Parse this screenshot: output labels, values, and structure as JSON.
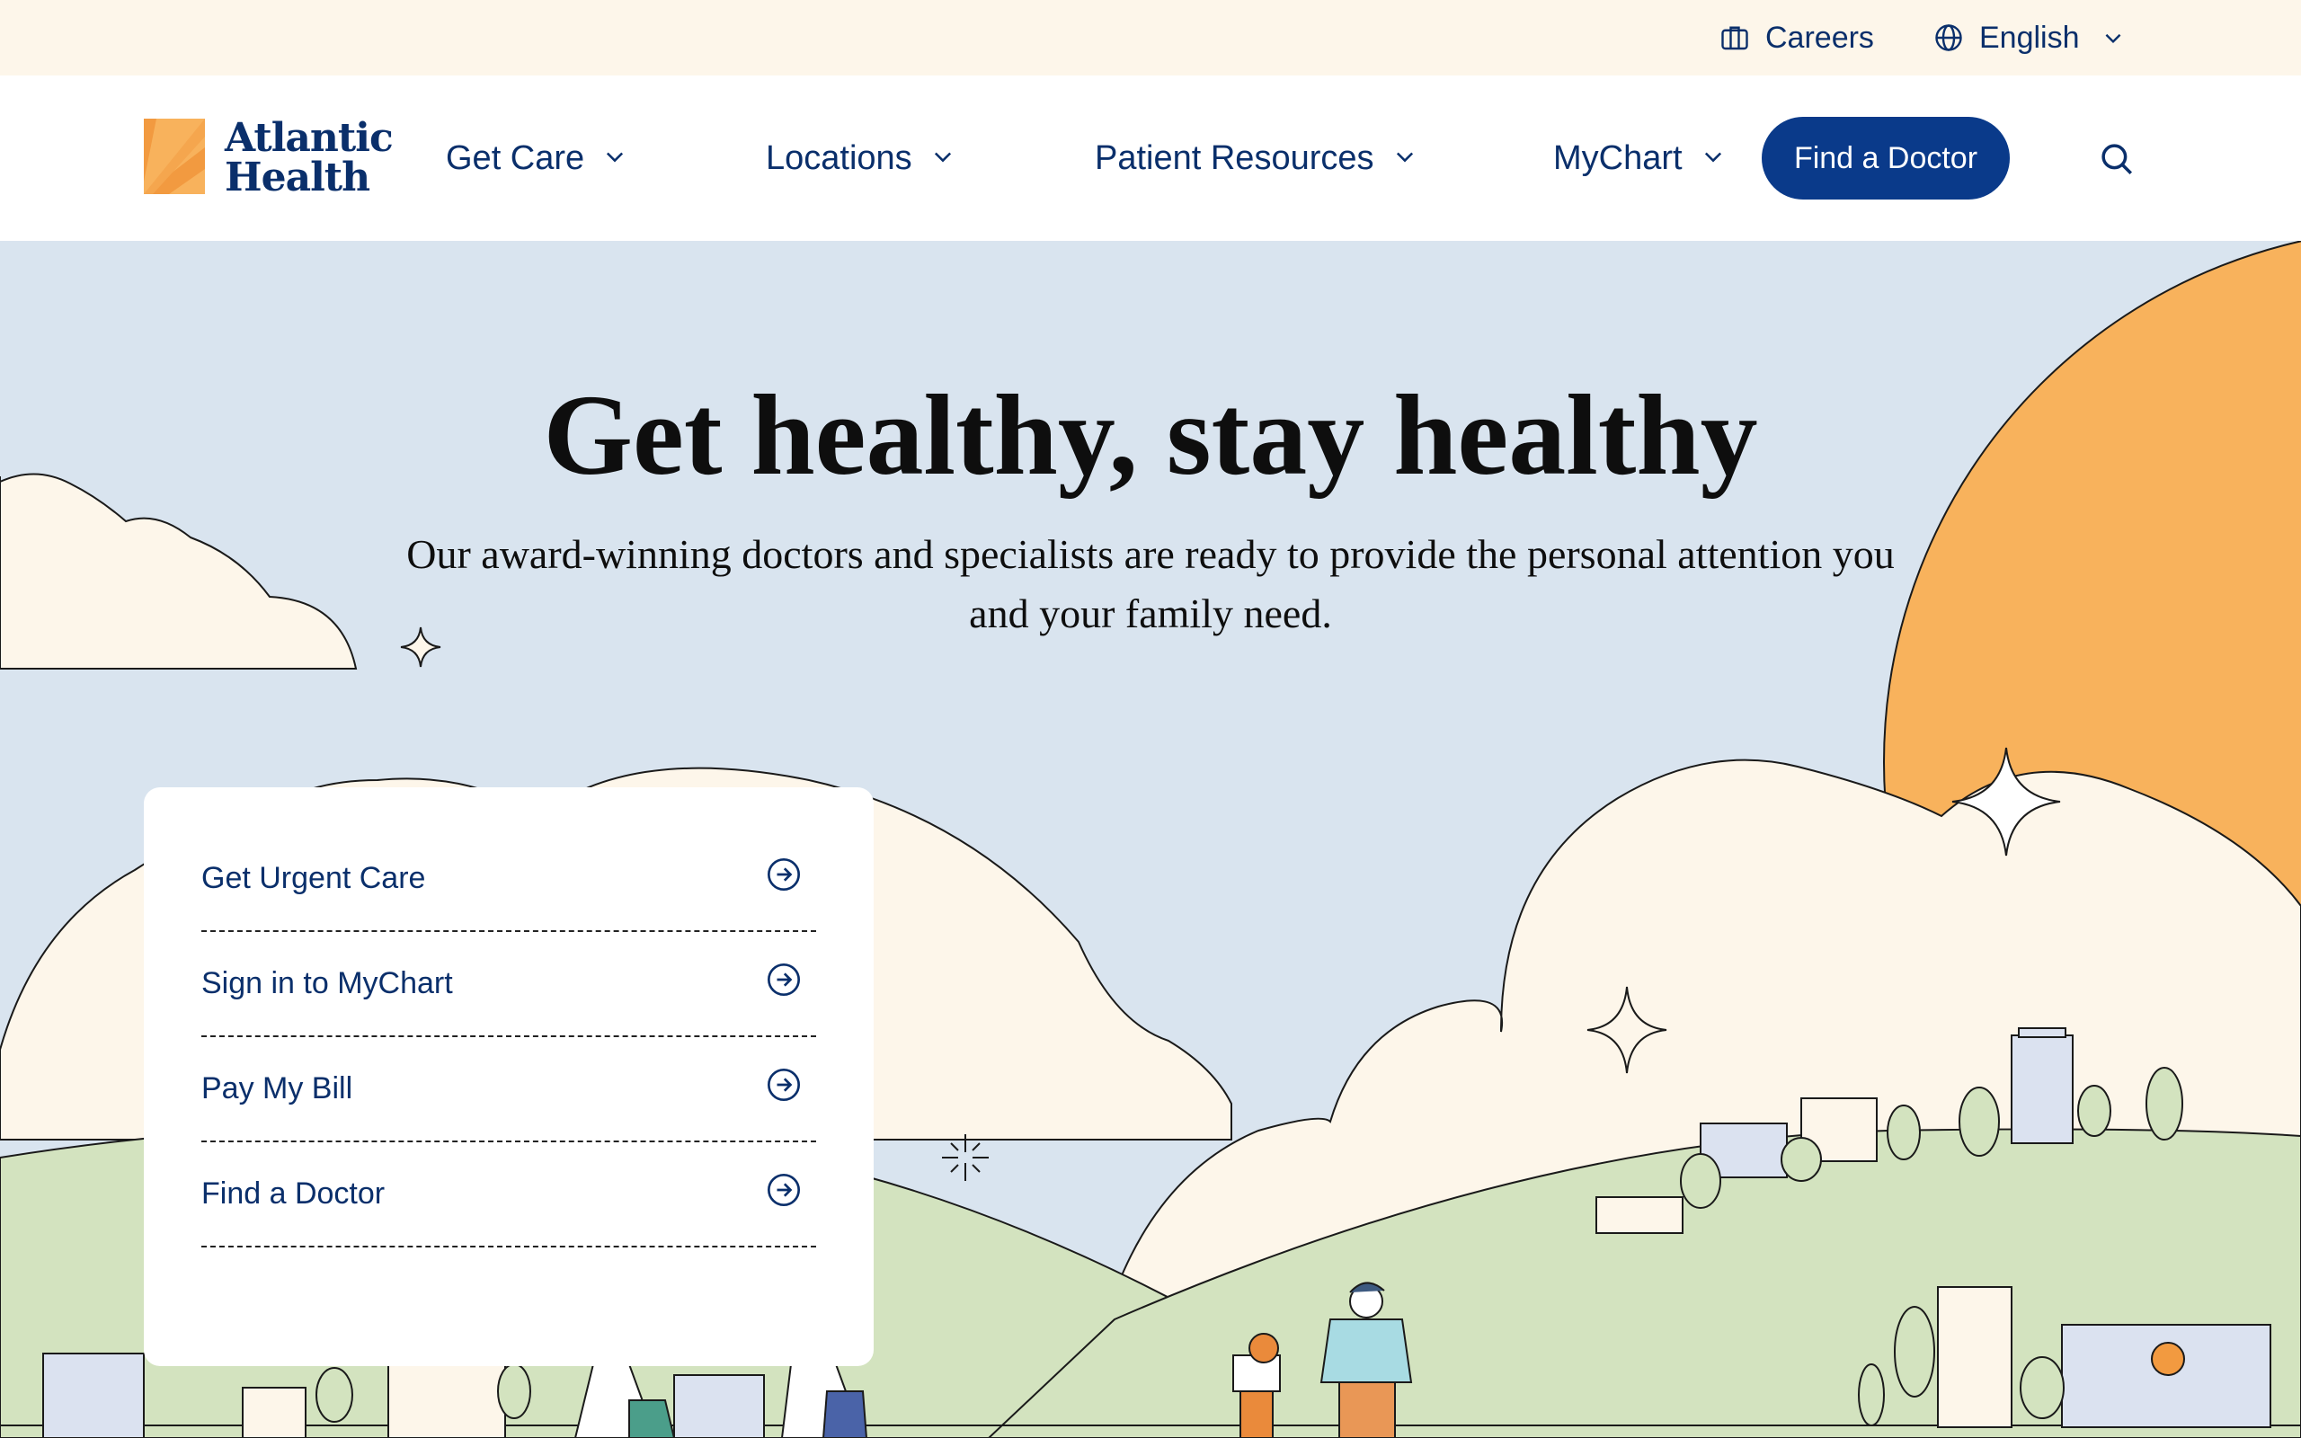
{
  "utility": {
    "careers_label": "Careers",
    "language_label": "English"
  },
  "nav": {
    "logo_line1": "Atlantic",
    "logo_line2": "Health",
    "items": [
      {
        "label": "Get Care"
      },
      {
        "label": "Locations"
      },
      {
        "label": "Patient Resources"
      },
      {
        "label": "MyChart"
      }
    ],
    "cta_label": "Find a Doctor"
  },
  "hero": {
    "title": "Get healthy, stay healthy",
    "subtitle": "Our award-winning doctors and specialists are ready to provide the personal attention you and your family need."
  },
  "quick_links": [
    {
      "label": "Get Urgent Care"
    },
    {
      "label": "Sign in to MyChart"
    },
    {
      "label": "Pay My Bill"
    },
    {
      "label": "Find a Doctor"
    }
  ],
  "colors": {
    "brand_navy": "#0a3a8a",
    "text_navy": "#0a2f6b",
    "sky": "#d9e4ef",
    "cream": "#fdf6ea",
    "sun": "#f8b25c",
    "hill": "#d3e3bf"
  }
}
